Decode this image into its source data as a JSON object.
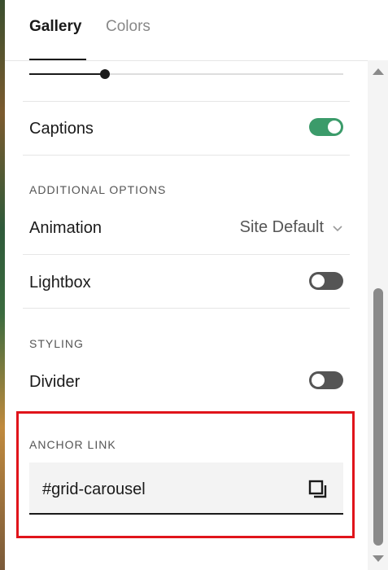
{
  "tabs": [
    {
      "label": "Gallery",
      "active": true
    },
    {
      "label": "Colors",
      "active": false
    }
  ],
  "slider": {
    "value_fraction": 0.24
  },
  "captions": {
    "label": "Captions",
    "enabled": true
  },
  "additional_options": {
    "section_label": "ADDITIONAL OPTIONS",
    "animation": {
      "label": "Animation",
      "value": "Site Default"
    },
    "lightbox": {
      "label": "Lightbox",
      "enabled": false
    }
  },
  "styling": {
    "section_label": "STYLING",
    "divider": {
      "label": "Divider",
      "enabled": false
    }
  },
  "anchor_link": {
    "section_label": "ANCHOR LINK",
    "value": "#grid-carousel"
  },
  "colors": {
    "toggle_on": "#3b9b6a",
    "toggle_off": "#555555",
    "highlight_border": "#e0141b"
  },
  "icons": {
    "dropdown": "chevron-down-icon",
    "copy": "copy-icon"
  }
}
